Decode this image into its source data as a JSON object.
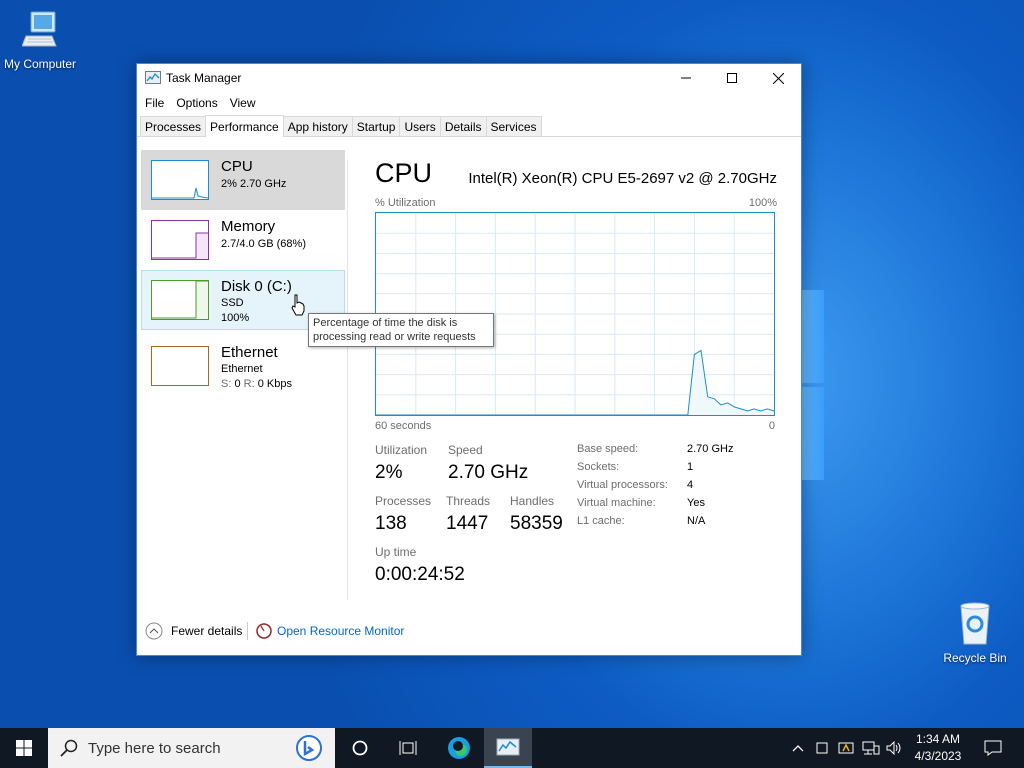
{
  "desktop": {
    "icons": [
      {
        "label": "My Computer"
      },
      {
        "label": "Recycle Bin"
      }
    ]
  },
  "window": {
    "title": "Task Manager",
    "menu": [
      "File",
      "Options",
      "View"
    ],
    "tabs": [
      "Processes",
      "Performance",
      "App history",
      "Startup",
      "Users",
      "Details",
      "Services"
    ],
    "active_tab": "Performance"
  },
  "resources": [
    {
      "name": "CPU",
      "line1": "2% 2.70 GHz",
      "line2": "",
      "color": "#1b8ec9"
    },
    {
      "name": "Memory",
      "line1": "2.7/4.0 GB (68%)",
      "line2": "",
      "color": "#8e30a6"
    },
    {
      "name": "Disk 0 (C:)",
      "line1": "SSD",
      "line2": "100%",
      "color": "#4c9a2a"
    },
    {
      "name": "Ethernet",
      "line1": "Ethernet",
      "line2_prefix_s": "S:",
      "line2_s": "0",
      "line2_prefix_r": "R:",
      "line2_r": "0 Kbps",
      "color": "#a7691f"
    }
  ],
  "tooltip": {
    "line1": "Percentage of time the disk is",
    "line2": "processing read or write requests"
  },
  "cpu_panel": {
    "title": "CPU",
    "model": "Intel(R) Xeon(R) CPU E5-2697 v2 @ 2.70GHz",
    "util_label": "% Utilization",
    "max_label": "100%",
    "time_left": "60 seconds",
    "time_right": "0",
    "stats": {
      "utilization_label": "Utilization",
      "utilization": "2%",
      "speed_label": "Speed",
      "speed": "2.70 GHz",
      "processes_label": "Processes",
      "processes": "138",
      "threads_label": "Threads",
      "threads": "1447",
      "handles_label": "Handles",
      "handles": "58359",
      "uptime_label": "Up time",
      "uptime": "0:00:24:52"
    },
    "details": [
      {
        "label": "Base speed:",
        "value": "2.70 GHz"
      },
      {
        "label": "Sockets:",
        "value": "1"
      },
      {
        "label": "Virtual processors:",
        "value": "4"
      },
      {
        "label": "Virtual machine:",
        "value": "Yes"
      },
      {
        "label": "L1 cache:",
        "value": "N/A"
      }
    ]
  },
  "chart_data": {
    "type": "area",
    "xlabel": "60 seconds",
    "ylabel": "% Utilization",
    "x": [
      60,
      57,
      54,
      51,
      48,
      45,
      42,
      39,
      36,
      33,
      30,
      27,
      24,
      21,
      18,
      15,
      14,
      13,
      12,
      11,
      10,
      9,
      8,
      7,
      6,
      5,
      4,
      3,
      2,
      1,
      0
    ],
    "values": [
      0,
      0,
      0,
      0,
      0,
      0,
      0,
      0,
      0,
      0,
      0,
      0,
      0,
      0,
      0,
      0,
      0,
      0,
      30,
      32,
      9,
      8,
      5,
      6,
      4,
      3,
      2,
      3,
      2,
      3,
      2
    ],
    "ylim": [
      0,
      100
    ]
  },
  "footer": {
    "fewer_details": "Fewer details",
    "open_monitor": "Open Resource Monitor"
  },
  "taskbar": {
    "search_placeholder": "Type here to search",
    "time": "1:34 AM",
    "date": "4/3/2023"
  }
}
